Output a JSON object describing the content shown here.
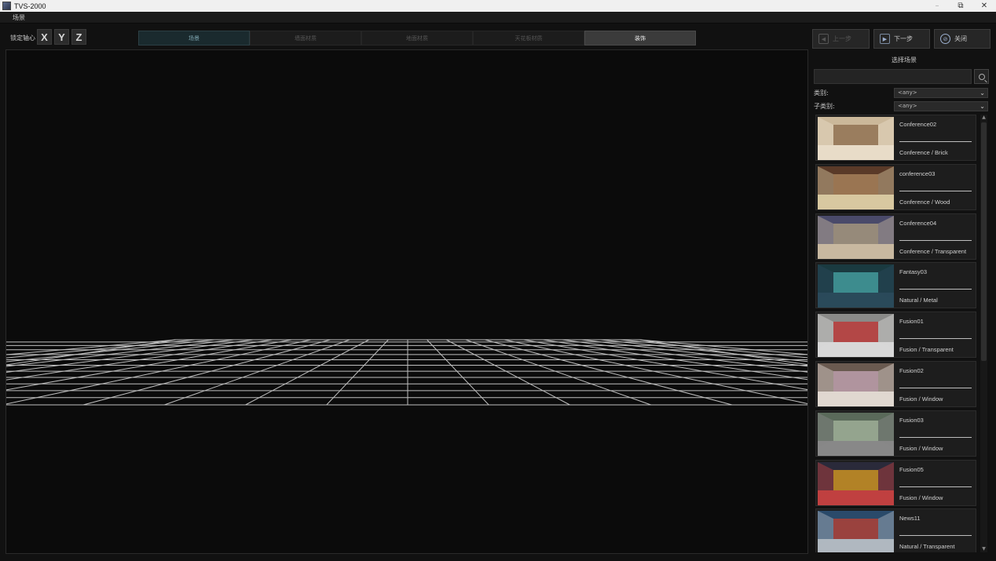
{
  "window": {
    "title": "TVS-2000"
  },
  "menu": {
    "file": "场景"
  },
  "toolbar": {
    "lock_label": "锁定轴心",
    "axes": [
      "X",
      "Y",
      "Z"
    ],
    "tabs": [
      "场景",
      "墙面材质",
      "地面材质",
      "天花板材质",
      "装饰"
    ],
    "prev_label": "上一步",
    "next_label": "下一步",
    "close_label": "关闭"
  },
  "panel": {
    "title": "选择场景",
    "search_value": "",
    "category_label": "类别:",
    "category_value": "<any>",
    "subcategory_label": "子类别:",
    "subcategory_value": "<any>",
    "scenes": [
      {
        "name": "Conference02",
        "category": "Conference / Brick",
        "thumb": [
          "#cbb89a",
          "#8a6a4a",
          "#e8dcc8"
        ]
      },
      {
        "name": "conference03",
        "category": "Conference / Wood",
        "thumb": [
          "#5a3a28",
          "#b08a60",
          "#d8c8a0"
        ]
      },
      {
        "name": "Conference04",
        "category": "Conference / Transparent",
        "thumb": [
          "#4a4a6a",
          "#b0a080",
          "#c8b8a0"
        ]
      },
      {
        "name": "Fantasy03",
        "category": "Natural / Metal",
        "thumb": [
          "#1a3a40",
          "#4aa8a8",
          "#2a4a5a"
        ]
      },
      {
        "name": "Fusion01",
        "category": "Fusion / Transparent",
        "thumb": [
          "#8a8a88",
          "#c03030",
          "#d8d8d8"
        ]
      },
      {
        "name": "Fusion02",
        "category": "Fusion / Window",
        "thumb": [
          "#6a5a50",
          "#c8a8b8",
          "#e0d8d0"
        ]
      },
      {
        "name": "Fusion03",
        "category": "Fusion / Window",
        "thumb": [
          "#5a6a5a",
          "#a8b8a0",
          "#888888"
        ]
      },
      {
        "name": "Fusion05",
        "category": "Fusion / Window",
        "thumb": [
          "#2a2a3a",
          "#e0a020",
          "#c04040"
        ]
      },
      {
        "name": "News11",
        "category": "Natural / Transparent",
        "thumb": [
          "#2a4a6a",
          "#c04030",
          "#b0b8c0"
        ]
      }
    ]
  },
  "colors": {
    "accent": "#7fa5b0",
    "grid": "#bfbfbf"
  }
}
